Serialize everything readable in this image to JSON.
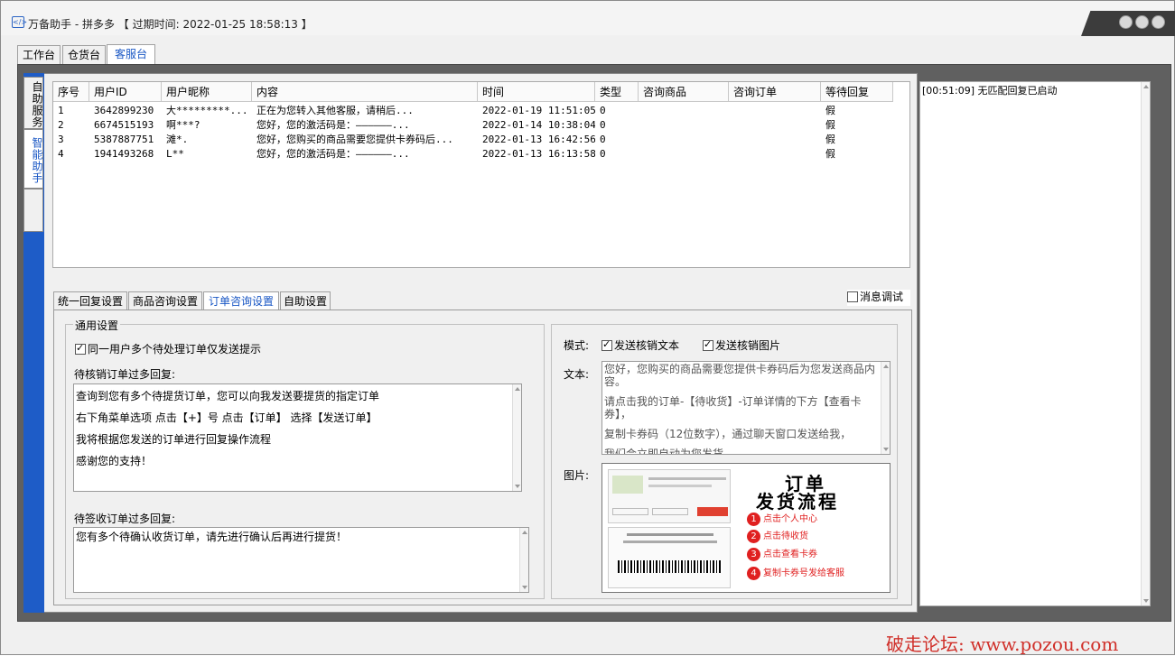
{
  "window": {
    "app_name": "万备助手",
    "title": "万备助手 - 拼多多 【 过期时间: 2022-01-25 18:58:13 】"
  },
  "top_tabs": [
    "工作台",
    "仓货台",
    "客服台"
  ],
  "side_tabs": [
    "自助服务",
    "智能助手"
  ],
  "log": {
    "lines": [
      "[00:51:09] 无匹配回复已启动"
    ]
  },
  "table": {
    "columns": [
      "序号",
      "用户ID",
      "用户昵称",
      "内容",
      "时间",
      "类型",
      "咨询商品",
      "咨询订单",
      "等待回复"
    ],
    "rows": [
      [
        "1",
        "3642899230",
        "大*********...",
        "正在为您转入其他客服，请稍后...",
        "2022-01-19 11:51:05",
        "0",
        "",
        "",
        "假"
      ],
      [
        "2",
        "6674515193",
        "啊***?",
        "您好，您的激活码是：——————...",
        "2022-01-14 10:38:04",
        "0",
        "",
        "",
        "假"
      ],
      [
        "3",
        "5387887751",
        "滩*.",
        "您好，您购买的商品需要您提供卡券码后...",
        "2022-01-13 16:42:56",
        "0",
        "",
        "",
        "假"
      ],
      [
        "4",
        "1941493268",
        "L**",
        "您好，您的激活码是：——————...",
        "2022-01-13 16:13:58",
        "0",
        "",
        "",
        "假"
      ]
    ]
  },
  "sub_tabs": [
    "统一回复设置",
    "商品咨询设置",
    "订单咨询设置",
    "自助设置"
  ],
  "debug_label": "消息调试",
  "general": {
    "group_label": "通用设置",
    "only_prompt_label": "同一用户多个待处理订单仅发送提示",
    "pending_verify_label": "待核销订单过多回复:",
    "pending_verify_lines": [
      "查询到您有多个待提货订单，您可以向我发送要提货的指定订单",
      "右下角菜单选项 点击【+】号 点击【订单】 选择【发送订单】",
      "我将根据您发送的订单进行回复操作流程",
      "感谢您的支持！"
    ],
    "pending_receipt_label": "待签收订单过多回复:",
    "pending_receipt_text": "您有多个待确认收货订单，请先进行确认后再进行提货！"
  },
  "right": {
    "mode_label": "模式:",
    "send_text_label": "发送核销文本",
    "send_image_label": "发送核销图片",
    "text_label": "文本:",
    "text_lines": [
      "您好，您购买的商品需要您提供卡券码后为您发送商品内容。",
      "请点击我的订单-【待收货】-订单详情的下方【查看卡券】，",
      "复制卡券码（12位数字），通过聊天窗口发送给我，",
      "我们会立即自动为您发货。"
    ],
    "image_label": "图片:",
    "image": {
      "title1": "订单",
      "title2": "发货流程",
      "steps": [
        "点击个人中心",
        "点击待收货",
        "点击查看卡券",
        "复制卡券号发给客服"
      ]
    }
  },
  "watermark": "破走论坛: www.pozou.com"
}
